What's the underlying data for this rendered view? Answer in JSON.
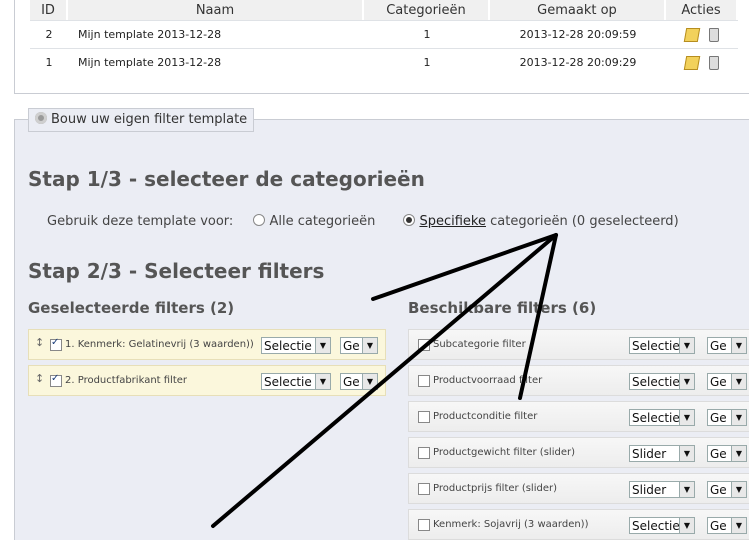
{
  "templates_table": {
    "headers": [
      "ID",
      "Naam",
      "Categorieën",
      "Gemaakt op",
      "Acties"
    ],
    "rows": [
      {
        "id": "2",
        "naam": "Mijn template 2013-12-28",
        "categorieen": "1",
        "gemaakt_op": "2013-12-28 20:09:59"
      },
      {
        "id": "1",
        "naam": "Mijn template 2013-12-28",
        "categorieen": "1",
        "gemaakt_op": "2013-12-28 20:09:29"
      }
    ]
  },
  "builder": {
    "legend": "Bouw uw eigen filter template",
    "step1_title": "Stap 1/3 - selecteer de categorieën",
    "usage_label": "Gebruik deze template voor:",
    "option_all": "Alle categorieën",
    "option_specific_link": "Specifieke",
    "option_specific_rest": "categorieën (0 geselecteerd)",
    "selected_option": "specific",
    "step2_title": "Stap 2/3 - Selecteer filters",
    "selected_filters_title": "Geselecteerde filters (2)",
    "available_filters_title": "Beschikbare filters (6)",
    "selected_filters": [
      {
        "label": "1. Kenmerk: Gelatinevrij (3 waarden))",
        "type": "Selectie",
        "extra": "Ge",
        "checked": true
      },
      {
        "label": "2. Productfabrikant filter",
        "type": "Selectie",
        "extra": "Ge",
        "checked": true
      }
    ],
    "available_filters": [
      {
        "label": "Subcategorie filter",
        "type": "Selectie",
        "extra": "Ge"
      },
      {
        "label": "Productvoorraad filter",
        "type": "Selectie",
        "extra": "Ge"
      },
      {
        "label": "Productconditie filter",
        "type": "Selectie",
        "extra": "Ge"
      },
      {
        "label": "Productgewicht filter (slider)",
        "type": "Slider",
        "extra": "Ge"
      },
      {
        "label": "Productprijs filter (slider)",
        "type": "Slider",
        "extra": "Ge"
      },
      {
        "label": "Kenmerk: Sojavrij (3 waarden))",
        "type": "Selectie",
        "extra": "Ge"
      }
    ]
  },
  "icons": {
    "edit": "pencil-edit-icon",
    "delete": "trash-icon",
    "gear": "gear-icon",
    "drag": "drag-handle-icon",
    "dropdown": "chevron-down-icon"
  },
  "colors": {
    "builder_bg": "#ebedf4",
    "selected_row_bg": "#fbf7dc",
    "heading": "#555555",
    "annotation_arrows": "#000000"
  }
}
